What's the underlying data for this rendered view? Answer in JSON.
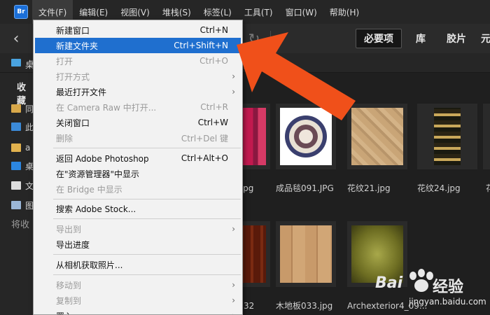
{
  "app": {
    "logo": "Br"
  },
  "menubar": [
    {
      "label": "文件(F)",
      "active": true
    },
    {
      "label": "编辑(E)"
    },
    {
      "label": "视图(V)"
    },
    {
      "label": "堆栈(S)"
    },
    {
      "label": "标签(L)"
    },
    {
      "label": "工具(T)"
    },
    {
      "label": "窗口(W)"
    },
    {
      "label": "帮助(H)"
    }
  ],
  "toolbar": {
    "workspaces": [
      "必要项",
      "库",
      "胶片",
      "元"
    ]
  },
  "pathbar": {
    "text": "桌",
    "text2": "加"
  },
  "leftpanel": {
    "title": "收藏",
    "items": [
      {
        "label": "同"
      },
      {
        "label": "此"
      },
      {
        "label": "a"
      },
      {
        "label": "桌"
      },
      {
        "label": "文"
      },
      {
        "label": "图"
      }
    ],
    "hint": "将收"
  },
  "thumbnails": [
    {
      "caption": ".jpg"
    },
    {
      "caption": "成品毯091.JPG"
    },
    {
      "caption": "花纹21.jpg"
    },
    {
      "caption": "花纹24.jpg"
    },
    {
      "caption": "花"
    },
    {
      "caption": "32"
    },
    {
      "caption": "木地板033.jpg"
    },
    {
      "caption": "Archexterior4_09..."
    }
  ],
  "file_menu": [
    {
      "label": "新建窗口",
      "shortcut": "Ctrl+N"
    },
    {
      "label": "新建文件夹",
      "shortcut": "Ctrl+Shift+N",
      "highlight": true
    },
    {
      "label": "打开",
      "shortcut": "Ctrl+O",
      "disabled": true
    },
    {
      "label": "打开方式",
      "submenu": true,
      "disabled": true
    },
    {
      "label": "最近打开文件",
      "submenu": true
    },
    {
      "label": "在 Camera Raw 中打开...",
      "shortcut": "Ctrl+R",
      "disabled": true
    },
    {
      "label": "关闭窗口",
      "shortcut": "Ctrl+W"
    },
    {
      "label": "删除",
      "shortcut": "Ctrl+Del 键",
      "disabled": true
    },
    {
      "label": "返回 Adobe Photoshop",
      "shortcut": "Ctrl+Alt+O"
    },
    {
      "label": "在\"资源管理器\"中显示"
    },
    {
      "label": "在 Bridge 中显示",
      "disabled": true
    },
    {
      "label": "搜索 Adobe Stock..."
    },
    {
      "label": "导出到",
      "submenu": true,
      "disabled": true
    },
    {
      "label": "导出进度"
    },
    {
      "label": "从相机获取照片..."
    },
    {
      "label": "移动到",
      "submenu": true,
      "disabled": true
    },
    {
      "label": "复制到",
      "submenu": true,
      "disabled": true
    },
    {
      "label": "置入",
      "submenu": true
    }
  ],
  "watermark": {
    "brand": "Bai",
    "brand2": "经验",
    "url": "jingyan.baidu.com"
  },
  "colors": {
    "accent": "#1f6fcf",
    "arrow": "#f0501a"
  }
}
